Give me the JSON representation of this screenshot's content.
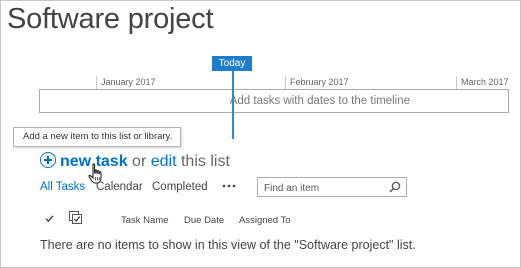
{
  "page": {
    "title": "Software project"
  },
  "timeline": {
    "today_label": "Today",
    "months": [
      "January 2017",
      "February 2017",
      "March 2017"
    ],
    "hint": "Add tasks with dates to the timeline"
  },
  "tooltip": {
    "text": "Add a new item to this list or library."
  },
  "commands": {
    "new_task": "new task",
    "or": "or",
    "edit": "edit",
    "this_list": "this list"
  },
  "views": {
    "tabs": [
      "All Tasks",
      "Calendar",
      "Completed"
    ],
    "active": "All Tasks",
    "more": "•••"
  },
  "search": {
    "placeholder": "Find an item"
  },
  "columns": [
    "Task Name",
    "Due Date",
    "Assigned To"
  ],
  "empty_message": "There are no items to show in this view of the \"Software project\" list.",
  "colors": {
    "accent": "#0072c6",
    "today": "#1f7ecb",
    "text": "#444444"
  }
}
